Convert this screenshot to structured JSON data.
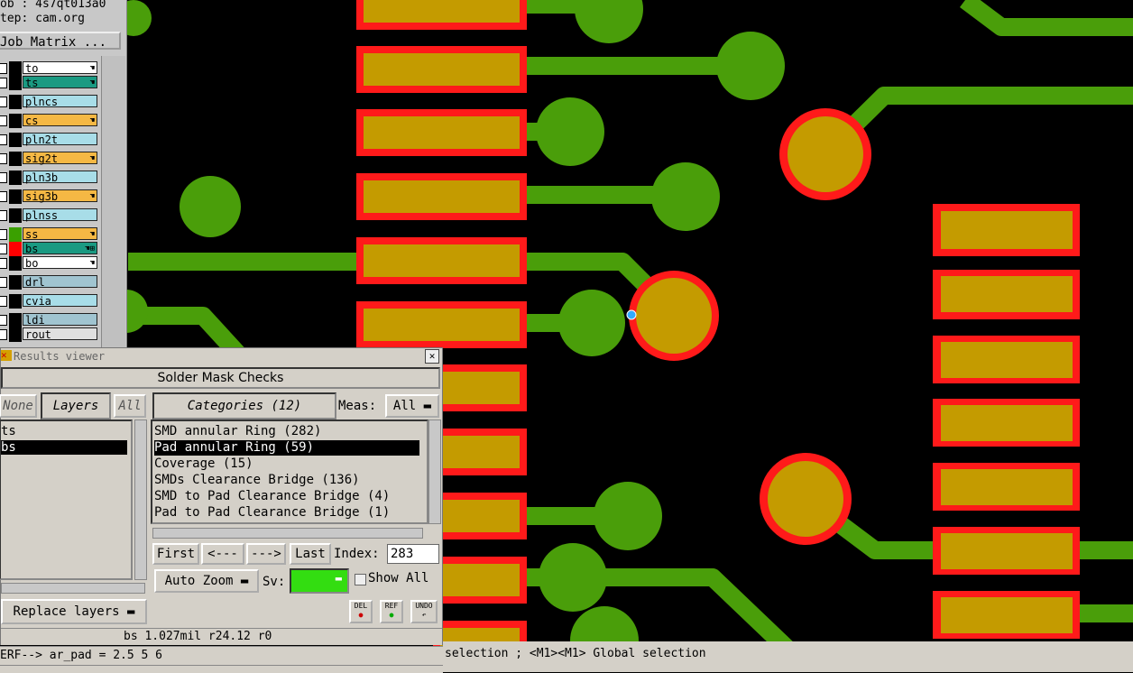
{
  "left_panel": {
    "job_line": "ob : 4s7qt013a0",
    "step_line": "tep: cam.org",
    "job_matrix_button": "Job Matrix ...",
    "layers": [
      {
        "name": "to",
        "bg": "#ffffff",
        "color": "#000000",
        "mark": "☚"
      },
      {
        "name": "ts",
        "bg": "#1a9a82",
        "color": "#000000",
        "mark": "☚"
      },
      {
        "name": "plncs",
        "bg": "#a8dde8",
        "color": "#000000",
        "mark": ""
      },
      {
        "name": "cs",
        "bg": "#f5b844",
        "color": "#000000",
        "mark": "☚"
      },
      {
        "name": "pln2t",
        "bg": "#a8dde8",
        "color": "#000000",
        "mark": ""
      },
      {
        "name": "sig2t",
        "bg": "#f5b844",
        "color": "#000000",
        "mark": "☚"
      },
      {
        "name": "pln3b",
        "bg": "#a8dde8",
        "color": "#000000",
        "mark": ""
      },
      {
        "name": "sig3b",
        "bg": "#f5b844",
        "color": "#000000",
        "mark": "☚"
      },
      {
        "name": "plnss",
        "bg": "#a8dde8",
        "color": "#000000",
        "mark": ""
      },
      {
        "name": "ss",
        "bg": "#f5b844",
        "color": "#3aa000",
        "mark": "☚"
      },
      {
        "name": "bs",
        "bg": "#1a9a82",
        "color": "#ff0000",
        "mark": "☚⊞"
      },
      {
        "name": "bo",
        "bg": "#ffffff",
        "color": "#000000",
        "mark": "☚"
      },
      {
        "name": "drl",
        "bg": "#a0c4d0",
        "color": "#000000",
        "mark": ""
      },
      {
        "name": "cvia",
        "bg": "#a8dde8",
        "color": "#000000",
        "mark": ""
      },
      {
        "name": "ldi",
        "bg": "#a0c4d0",
        "color": "#000000",
        "mark": ""
      },
      {
        "name": "rout",
        "bg": "#e0e0e0",
        "color": "#000000",
        "mark": ""
      }
    ]
  },
  "results_viewer": {
    "window_title": "Results viewer",
    "header": "Solder Mask Checks",
    "none_button": "None",
    "layers_button": "Layers",
    "all_button": "All",
    "categories_button": "Categories (12)",
    "meas_label": "Meas:",
    "meas_value": "All",
    "layer_list": [
      "ts",
      "bs"
    ],
    "category_list": [
      "SMD annular Ring (282)",
      "Pad annular Ring (59)",
      "Coverage (15)",
      "SMDs Clearance Bridge (136)",
      "SMD to Pad Clearance Bridge (4)",
      "Pad to Pad Clearance Bridge (1)"
    ],
    "first_button": "First",
    "prev_button": "<---",
    "next_button": "--->",
    "last_button": "Last",
    "index_label": "Index:",
    "index_value": "283",
    "auto_zoom_button": "Auto Zoom",
    "sv_label": "Sv:",
    "show_all_label": "Show All",
    "replace_layers_button": "Replace layers",
    "del_button": "DEL",
    "ref_button": "REF",
    "undo_button": "UNDO",
    "status_line": "bs 1.027mil  r24.12  r0",
    "command_line": "ERF--> ar_pad = 2.5 5 6"
  },
  "bottom_status": "selection ; <M1><M1> Global selection",
  "colors": {
    "trace": "#4a9e0a",
    "pad_fill": "#c49b00",
    "mask": "#ff1a1a",
    "bg": "#000000"
  }
}
